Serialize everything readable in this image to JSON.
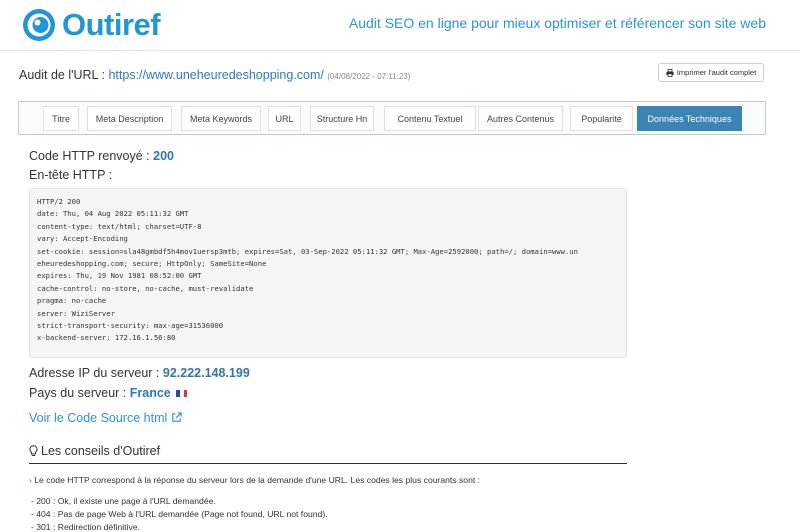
{
  "header": {
    "logo_text": "Outiref",
    "tagline": "Audit SEO en ligne pour mieux optimiser et référencer son site web"
  },
  "audit": {
    "prefix": "Audit de l'URL :",
    "url": "https://www.uneheuredeshopping.com/",
    "date": "(04/08/2022 - 07:11:23)",
    "print_label": "Imprimer l'audit complet"
  },
  "tabs": [
    {
      "label": "Titre"
    },
    {
      "label": "Meta Description"
    },
    {
      "label": "Meta Keywords"
    },
    {
      "label": "URL"
    },
    {
      "label": "Structure Hn"
    },
    {
      "label": "Contenu Textuel"
    },
    {
      "label": "Autres Contenus"
    },
    {
      "label": "Popularité"
    },
    {
      "label": "Données Techniques"
    }
  ],
  "technical": {
    "http_code_label": "Code HTTP renvoyé :",
    "http_code": "200",
    "header_label": "En-tête HTTP :",
    "http_header_lines": [
      "HTTP/2 200",
      "date: Thu, 04 Aug 2022 05:11:32 GMT",
      "content-type: text/html; charset=UTF-8",
      "vary: Accept-Encoding",
      "set-cookie: session=sla48gmbdf5h4mov1uersp3mtb; expires=Sat, 03-Sep-2022 05:11:32 GMT; Max-Age=2592000; path=/; domain=www.un",
      "eheuredeshopping.com; secure; HttpOnly; SameSite=None",
      "expires: Thu, 19 Nov 1981 08:52:00 GMT",
      "cache-control: no-store, no-cache, must-revalidate",
      "pragma: no-cache",
      "server: WiziServer",
      "strict-transport-security: max-age=31536000",
      "x-backend-server: 172.16.1.56:80"
    ],
    "ip_label": "Adresse IP du serveur :",
    "ip": "92.222.148.199",
    "country_label": "Pays du serveur :",
    "country": "France",
    "source_link": "Voir le Code Source html"
  },
  "advice": {
    "title": "Les conseils d'Outiref",
    "intro": "Le code HTTP correspond à la réponse du serveur lors de la demande d'une URL. Les codes les plus courants sont :",
    "items": [
      "- 200 : Ok, il existe une page à l'URL demandée.",
      "- 404 : Pas de page Web à l'URL demandée (Page not found, URL not found).",
      "- 301 : Redirection définitive."
    ]
  },
  "colors": {
    "brand": "#2196d6",
    "active_tab": "#3b84b4",
    "value": "#3274b4"
  }
}
